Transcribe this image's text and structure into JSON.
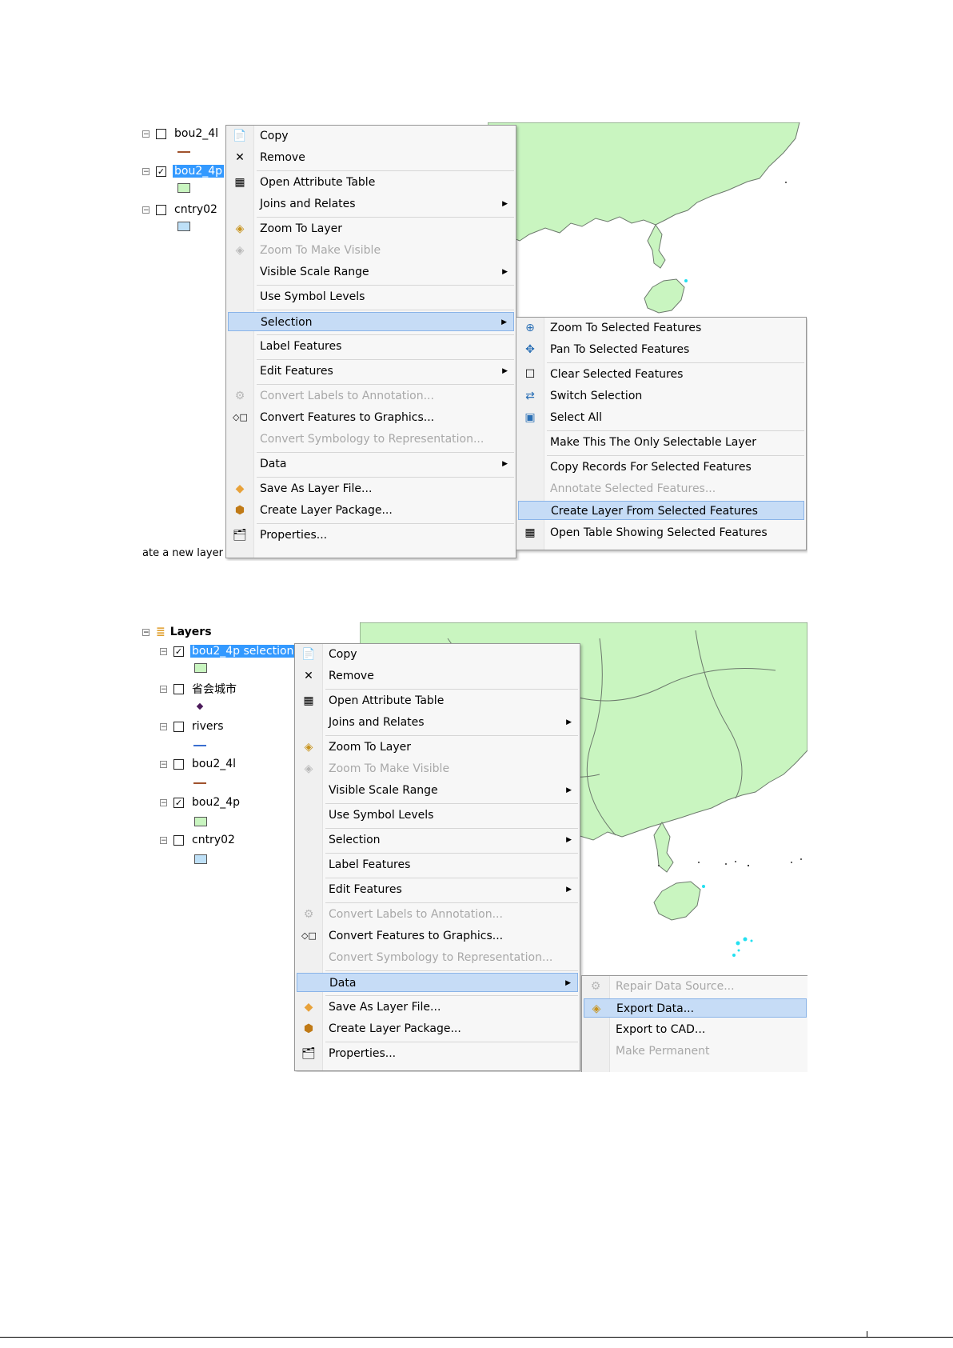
{
  "screenshot1": {
    "toc": {
      "layers": [
        {
          "name": "bou2_4l",
          "checked": false,
          "selected": false
        },
        {
          "name": "bou2_4p",
          "checked": true,
          "selected": true
        },
        {
          "name": "cntry02",
          "checked": false,
          "selected": false
        }
      ],
      "status_text": "ate a new layer"
    },
    "context_menu": {
      "items": [
        {
          "label": "Copy",
          "icon": "copy-icon"
        },
        {
          "label": "Remove",
          "icon": "remove-icon"
        },
        {
          "label": "Open Attribute Table",
          "icon": "table-icon"
        },
        {
          "label": "Joins and Relates",
          "submenu": true
        },
        {
          "label": "Zoom To Layer",
          "icon": "zoom-to-layer-icon"
        },
        {
          "label": "Zoom To Make Visible",
          "icon": "zoom-visible-icon",
          "disabled": true
        },
        {
          "label": "Visible Scale Range",
          "submenu": true
        },
        {
          "label": "Use Symbol Levels"
        },
        {
          "label": "Selection",
          "submenu": true,
          "highlighted": true
        },
        {
          "label": "Label Features"
        },
        {
          "label": "Edit Features",
          "submenu": true
        },
        {
          "label": "Convert Labels to Annotation...",
          "icon": "convert-labels-icon",
          "disabled": true
        },
        {
          "label": "Convert Features to Graphics...",
          "icon": "convert-graphics-icon"
        },
        {
          "label": "Convert Symbology to Representation...",
          "disabled": true
        },
        {
          "label": "Data",
          "submenu": true
        },
        {
          "label": "Save As Layer File...",
          "icon": "layer-file-icon"
        },
        {
          "label": "Create Layer Package...",
          "icon": "layer-package-icon"
        },
        {
          "label": "Properties...",
          "icon": "properties-icon"
        }
      ]
    },
    "submenu": {
      "items": [
        {
          "label": "Zoom To Selected Features",
          "icon": "zoom-selected-icon"
        },
        {
          "label": "Pan To Selected Features",
          "icon": "pan-selected-icon"
        },
        {
          "label": "Clear Selected Features",
          "icon": "clear-selection-icon"
        },
        {
          "label": "Switch Selection",
          "icon": "switch-selection-icon"
        },
        {
          "label": "Select All",
          "icon": "select-all-icon"
        },
        {
          "label": "Make This The Only Selectable Layer"
        },
        {
          "label": "Copy Records For Selected Features"
        },
        {
          "label": "Annotate Selected Features...",
          "disabled": true
        },
        {
          "label": "Create Layer From Selected Features",
          "highlighted": true
        },
        {
          "label": "Open Table Showing Selected Features",
          "icon": "table-icon"
        }
      ]
    }
  },
  "screenshot2": {
    "toc": {
      "root": "Layers",
      "layers": [
        {
          "name": "bou2_4p selection",
          "checked": true,
          "selected": true
        },
        {
          "name": "省会城市",
          "checked": false,
          "selected": false
        },
        {
          "name": "rivers",
          "checked": false,
          "selected": false
        },
        {
          "name": "bou2_4l",
          "checked": false,
          "selected": false
        },
        {
          "name": "bou2_4p",
          "checked": true,
          "selected": false
        },
        {
          "name": "cntry02",
          "checked": false,
          "selected": false
        }
      ]
    },
    "context_menu": {
      "items": [
        {
          "label": "Copy",
          "icon": "copy-icon"
        },
        {
          "label": "Remove",
          "icon": "remove-icon"
        },
        {
          "label": "Open Attribute Table",
          "icon": "table-icon"
        },
        {
          "label": "Joins and Relates",
          "submenu": true
        },
        {
          "label": "Zoom To Layer",
          "icon": "zoom-to-layer-icon"
        },
        {
          "label": "Zoom To Make Visible",
          "icon": "zoom-visible-icon",
          "disabled": true
        },
        {
          "label": "Visible Scale Range",
          "submenu": true
        },
        {
          "label": "Use Symbol Levels"
        },
        {
          "label": "Selection",
          "submenu": true
        },
        {
          "label": "Label Features"
        },
        {
          "label": "Edit Features",
          "submenu": true
        },
        {
          "label": "Convert Labels to Annotation...",
          "icon": "convert-labels-icon",
          "disabled": true
        },
        {
          "label": "Convert Features to Graphics...",
          "icon": "convert-graphics-icon"
        },
        {
          "label": "Convert Symbology to Representation...",
          "disabled": true
        },
        {
          "label": "Data",
          "submenu": true,
          "highlighted": true
        },
        {
          "label": "Save As Layer File...",
          "icon": "layer-file-icon"
        },
        {
          "label": "Create Layer Package...",
          "icon": "layer-package-icon"
        },
        {
          "label": "Properties...",
          "icon": "properties-icon"
        }
      ]
    },
    "submenu": {
      "items": [
        {
          "label": "Repair Data Source...",
          "icon": "repair-icon",
          "disabled": true
        },
        {
          "label": "Export Data...",
          "icon": "export-icon",
          "highlighted": true
        },
        {
          "label": "Export to CAD..."
        },
        {
          "label": "Make Permanent",
          "disabled": true
        }
      ]
    }
  },
  "colors": {
    "land": "#c9f5c0",
    "border": "#6d7a6d",
    "highlight": "#c6dcf6",
    "selected_layer": "#3399ff",
    "island": "#22e0f0"
  }
}
